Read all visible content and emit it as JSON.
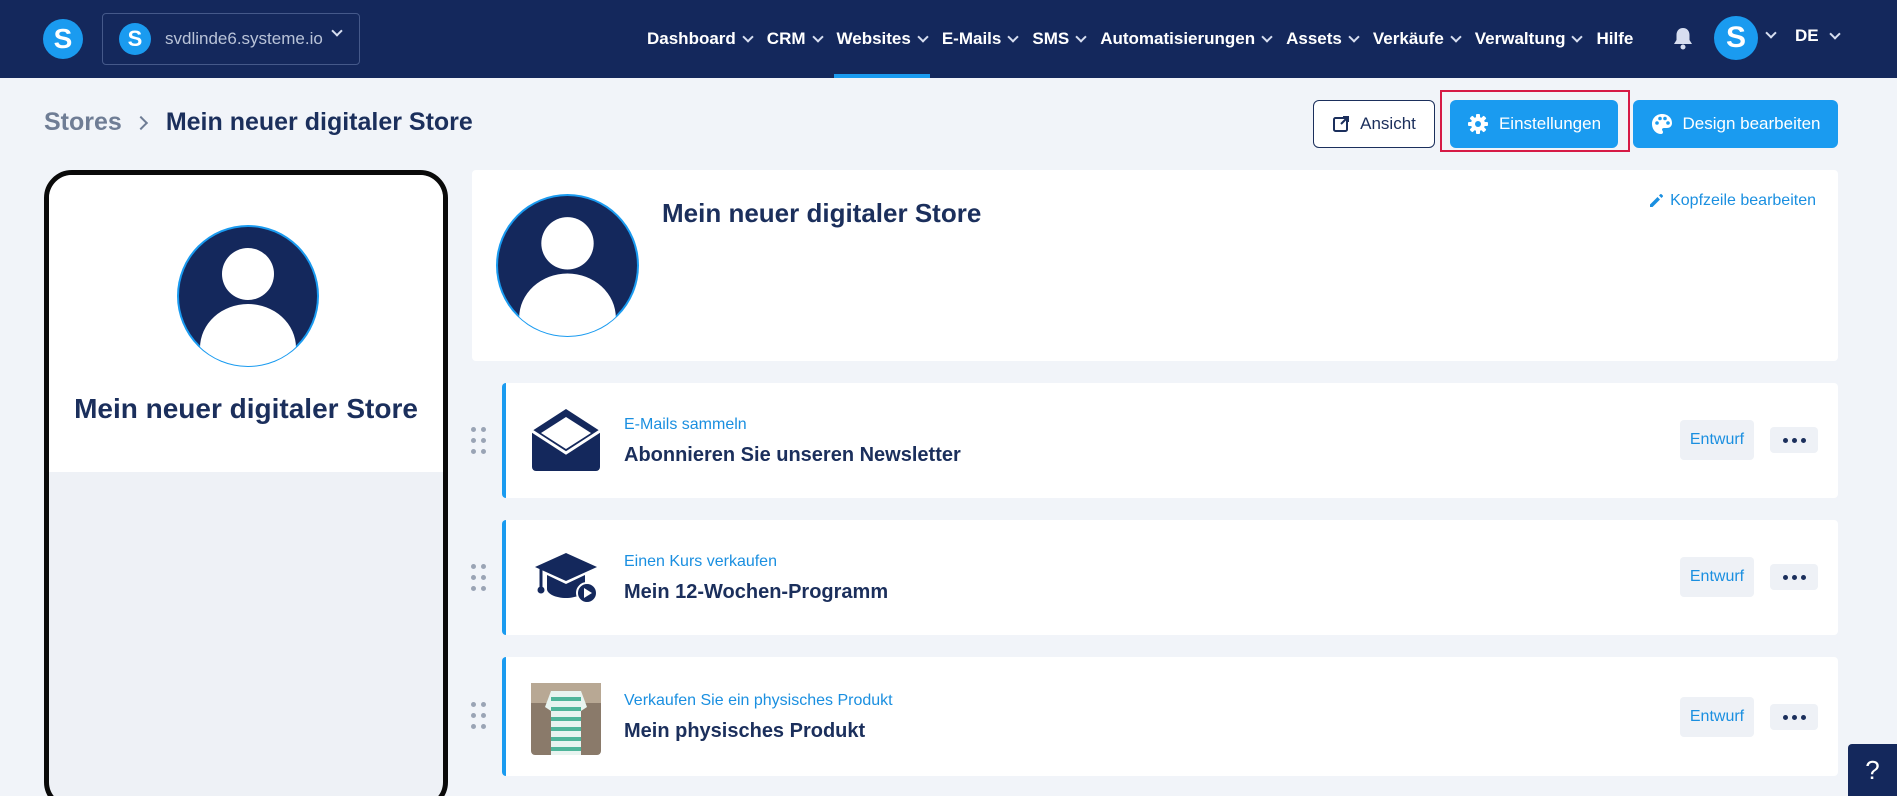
{
  "topbar": {
    "logo_letter": "S",
    "domain": "svdlinde6.systeme.io",
    "nav": [
      {
        "label": "Dashboard"
      },
      {
        "label": "CRM"
      },
      {
        "label": "Websites"
      },
      {
        "label": "E-Mails"
      },
      {
        "label": "SMS"
      },
      {
        "label": "Automatisierungen"
      },
      {
        "label": "Assets"
      },
      {
        "label": "Verkäufe"
      },
      {
        "label": "Verwaltung"
      },
      {
        "label": "Hilfe"
      }
    ],
    "active_nav": "Websites",
    "user_letter": "S",
    "language": "DE"
  },
  "breadcrumb": {
    "root": "Stores",
    "current": "Mein neuer digitaler Store"
  },
  "actions": {
    "view_label": "Ansicht",
    "settings_label": "Einstellungen",
    "design_label": "Design bearbeiten"
  },
  "annotation": {
    "marker": "31"
  },
  "phone_preview": {
    "title": "Mein neuer digitaler Store"
  },
  "store_header": {
    "title": "Mein neuer digitaler Store",
    "edit_label": "Kopfzeile bearbeiten"
  },
  "products": [
    {
      "category": "E-Mails sammeln",
      "title": "Abonnieren Sie unseren Newsletter",
      "status": "Entwurf",
      "icon": "envelope-icon"
    },
    {
      "category": "Einen Kurs verkaufen",
      "title": "Mein 12-Wochen-Programm",
      "status": "Entwurf",
      "icon": "graduation-cap-icon"
    },
    {
      "category": "Verkaufen Sie ein physisches Produkt",
      "title": "Mein physisches Produkt",
      "status": "Entwurf",
      "icon": "product-photo"
    }
  ],
  "help": {
    "label": "?"
  },
  "colors": {
    "navy": "#14285c",
    "accent": "#1a9bf0",
    "highlight": "#d61a46"
  }
}
